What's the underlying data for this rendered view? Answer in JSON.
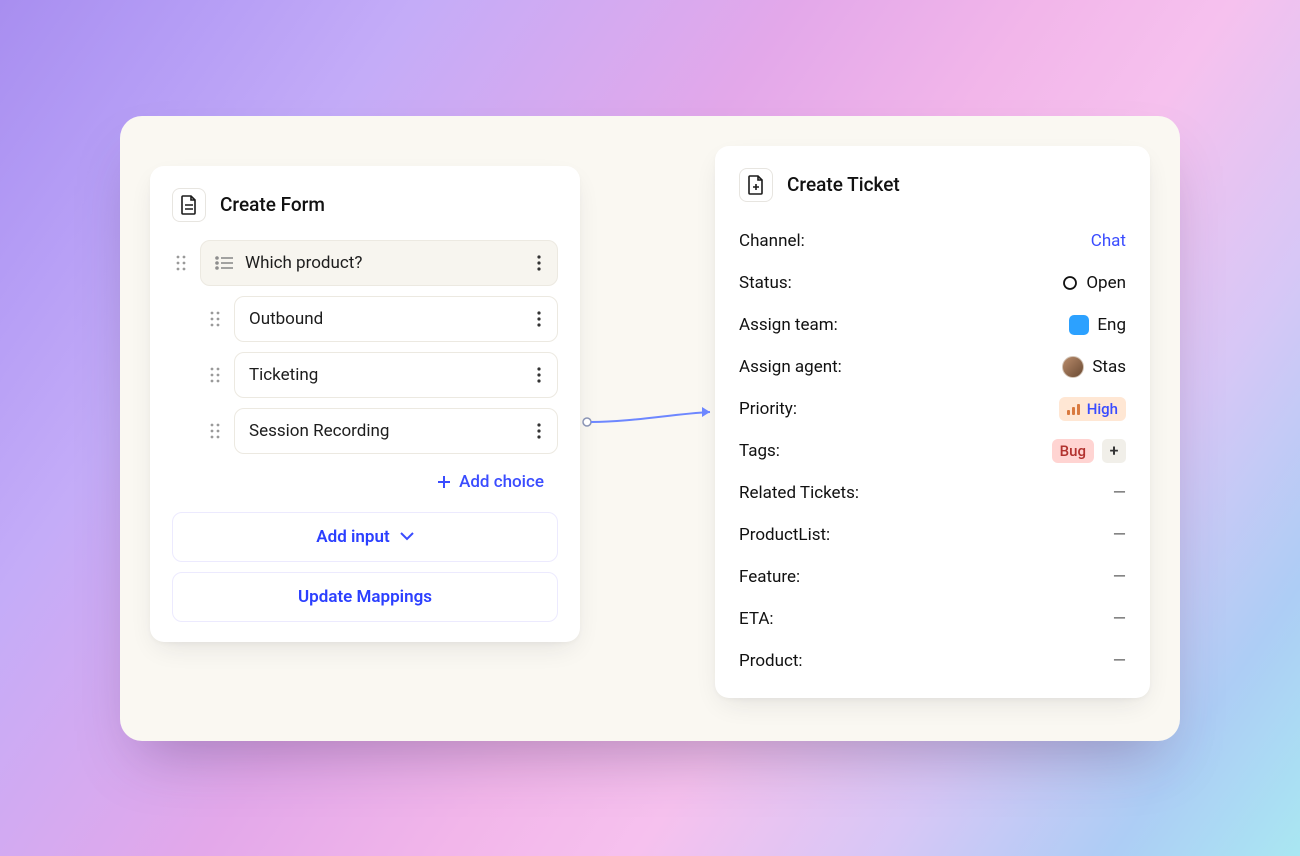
{
  "form_card": {
    "title": "Create Form",
    "question_label": "Which product?",
    "choices": [
      {
        "label": "Outbound"
      },
      {
        "label": "Ticketing"
      },
      {
        "label": "Session Recording"
      }
    ],
    "add_choice_label": "Add choice",
    "add_input_label": "Add input",
    "update_mappings_label": "Update Mappings"
  },
  "ticket_card": {
    "title": "Create Ticket",
    "rows": {
      "channel_label": "Channel:",
      "channel_value": "Chat",
      "status_label": "Status:",
      "status_value": "Open",
      "team_label": "Assign team:",
      "team_value": "Eng",
      "agent_label": "Assign agent:",
      "agent_value": "Stas",
      "priority_label": "Priority:",
      "priority_value": "High",
      "tags_label": "Tags:",
      "tag_value": "Bug",
      "related_label": "Related Tickets:",
      "productlist_label": "ProductList:",
      "feature_label": "Feature:",
      "eta_label": "ETA:",
      "product_label": "Product:",
      "empty_value": "—"
    }
  },
  "colors": {
    "accent": "#3a4cff",
    "team_swatch": "#2ca1ff",
    "priority_pill_bg": "#ffe7d4",
    "tag_pill_bg": "#ffd4d2"
  }
}
